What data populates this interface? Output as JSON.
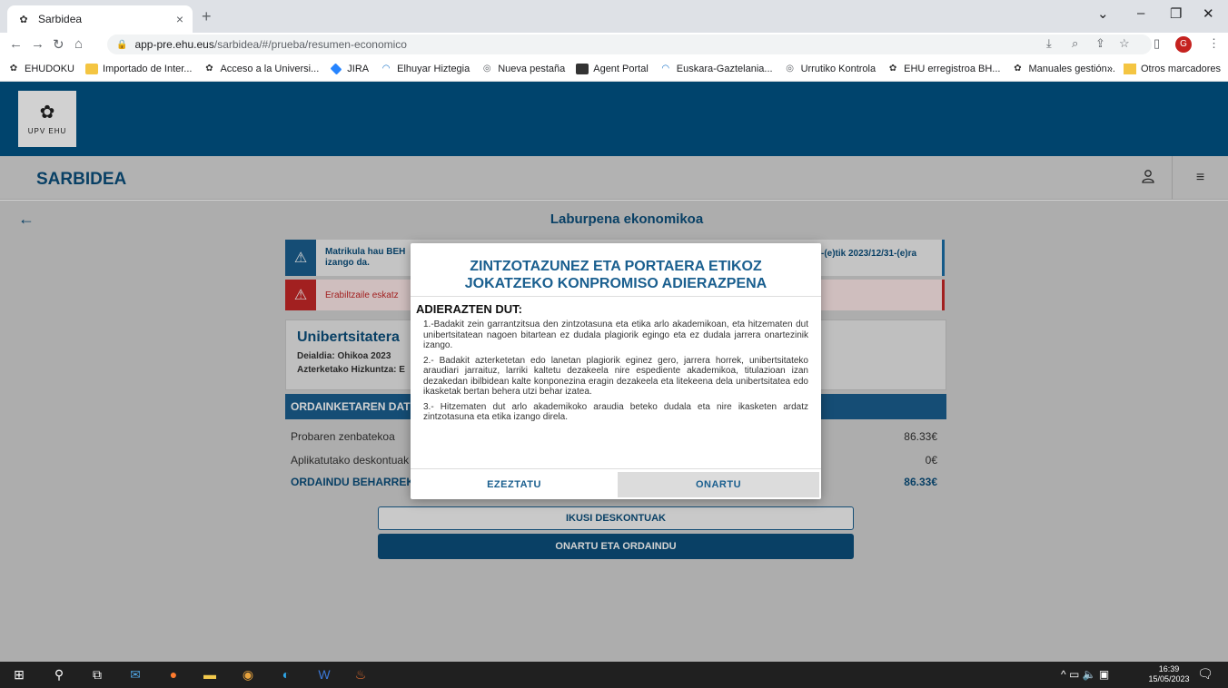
{
  "browser": {
    "tab_title": "Sarbidea",
    "tab_close": "×",
    "new_tab": "+",
    "url_host": "app-pre.ehu.eus",
    "url_path": "/sarbidea/#/prueba/resumen-economico",
    "profile_initial": "G",
    "bookmarks": [
      {
        "label": "EHUDOKU",
        "icon": "upv-icon"
      },
      {
        "label": "Importado de Inter...",
        "icon": "folder-icon"
      },
      {
        "label": "Acceso a la Universi...",
        "icon": "upv-icon"
      },
      {
        "label": "JIRA",
        "icon": "jira-icon"
      },
      {
        "label": "Elhuyar Hiztegia",
        "icon": "elhuyar-icon"
      },
      {
        "label": "Nueva pestaña",
        "icon": "globe-icon"
      },
      {
        "label": "Agent Portal",
        "icon": "agent-icon"
      },
      {
        "label": "Euskara-Gaztelania...",
        "icon": "elhuyar-icon"
      },
      {
        "label": "Urrutiko Kontrola",
        "icon": "globe-icon"
      },
      {
        "label": "EHU erregistroa BH...",
        "icon": "upv-icon"
      },
      {
        "label": "Manuales gestión...",
        "icon": "upv-icon"
      }
    ],
    "bookmarks_more": "»",
    "other_bookmarks": "Otros marcadores"
  },
  "header": {
    "logo_text": "UPV  EHU",
    "brand": "SARBIDEA"
  },
  "page": {
    "title": "Laburpena ekonomikoa",
    "info_alert_line1": "Matrikula hau BEH",
    "info_alert_line2": "izango da.",
    "info_alert_right": "-(e)tik 2023/12/31-(e)ra",
    "error_alert": "Erabiltzaile eskatz",
    "card_title": "Unibertsitatera",
    "card_call": "Deialdia: Ohikoa 2023",
    "card_lang": "Azterketako Hizkuntza: E",
    "payment_header": "ORDAINKETAREN DAT",
    "rows": [
      {
        "label": "Probaren zenbatekoa",
        "value": "86.33€"
      },
      {
        "label": "Aplikatutako deskontuak",
        "value": "0€"
      }
    ],
    "total_label": "ORDAINDU BEHARREK",
    "total_value": "86.33€",
    "btn_discounts": "IKUSI DESKONTUAK",
    "btn_pay": "ONARTU ETA ORDAINDU"
  },
  "modal": {
    "title": "ZINTZOTAZUNEZ ETA PORTAERA ETIKOZ JOKATZEKO KONPROMISO ADIERAZPENA",
    "heading": "ADIERAZTEN DUT:",
    "p1": "1.-Badakit zein garrantzitsua den zintzotasuna eta etika arlo akademikoan, eta hitzematen dut unibertsitatean nagoen bitartean ez dudala plagiorik egingo eta ez dudala jarrera onartezinik izango.",
    "p2": "2.- Badakit azterketetan edo lanetan plagiorik eginez gero, jarrera horrek, unibertsitateko araudiari jarraituz, larriki kaltetu dezakeela nire espediente akademikoa, titulazioan izan dezakedan ibilbidean kalte konponezina eragin dezakeela eta litekeena dela unibertsitatea edo ikasketak bertan behera utzi behar izatea.",
    "p3": "3.- Hitzematen dut arlo akademikoko araudia beteko dudala eta nire ikasketen ardatz zintzotasuna eta etika izango direla.",
    "cancel": "EZEZTATU",
    "accept": "ONARTU"
  },
  "taskbar": {
    "time": "16:39",
    "date": "15/05/2023"
  },
  "colors": {
    "brand_blue": "#005486",
    "title_blue": "#0b4f7c",
    "error_red": "#c62828"
  }
}
